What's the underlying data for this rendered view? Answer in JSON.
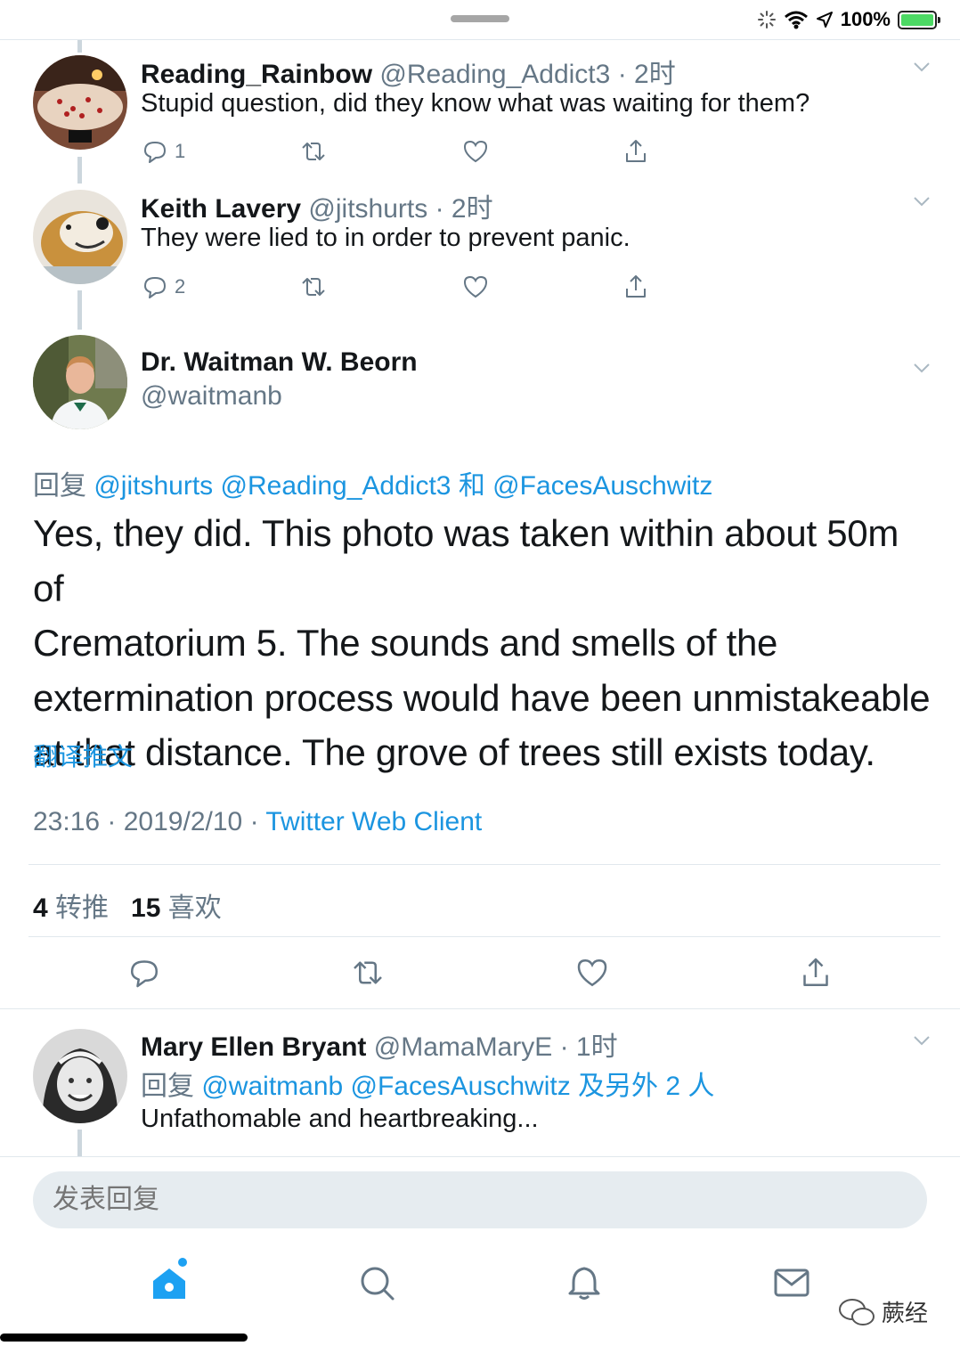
{
  "status_bar": {
    "battery": "100%"
  },
  "tweets": [
    {
      "name": "Reading_Rainbow",
      "handle": "@Reading_Addict3",
      "time": "· 2时",
      "text": "Stupid question, did they know what was waiting for them?",
      "reply_count": "1"
    },
    {
      "name": "Keith Lavery",
      "handle": "@jitshurts",
      "time": "· 2时",
      "text": "They were lied to in order to prevent panic.",
      "reply_count": "2"
    }
  ],
  "main_tweet": {
    "name": "Dr. Waitman W. Beorn",
    "handle": "@waitmanb",
    "reply_prefix": "回复",
    "reply_mention_1": "@jitshurts",
    "reply_mention_2": "@Reading_Addict3",
    "reply_and": "和",
    "reply_mention_3": "@FacesAuschwitz",
    "text_lines": [
      "Yes, they did.  This photo was taken within about 50m of",
      "Crematorium 5. The sounds and smells of the",
      "extermination process would have been unmistakeable",
      "at that distance.  The grove of trees still exists today."
    ],
    "translate_label": "翻译推文",
    "time": "23:16",
    "date": "2019/2/10",
    "source": "Twitter Web Client",
    "retweets": "4",
    "retweets_label": "转推",
    "likes": "15",
    "likes_label": "喜欢"
  },
  "reply": {
    "name": "Mary Ellen Bryant",
    "handle": "@MamaMaryE",
    "time": "· 1时",
    "reply_prefix": "回复",
    "reply_mentions": "@waitmanb @FacesAuschwitz 及另外 2 人",
    "text": "Unfathomable and heartbreaking..."
  },
  "composer": {
    "placeholder": "发表回复"
  },
  "watermark": "蕨经",
  "colors": {
    "accent": "#1b95e0",
    "secondary_text": "#657786",
    "divider": "#e1e8ed"
  }
}
